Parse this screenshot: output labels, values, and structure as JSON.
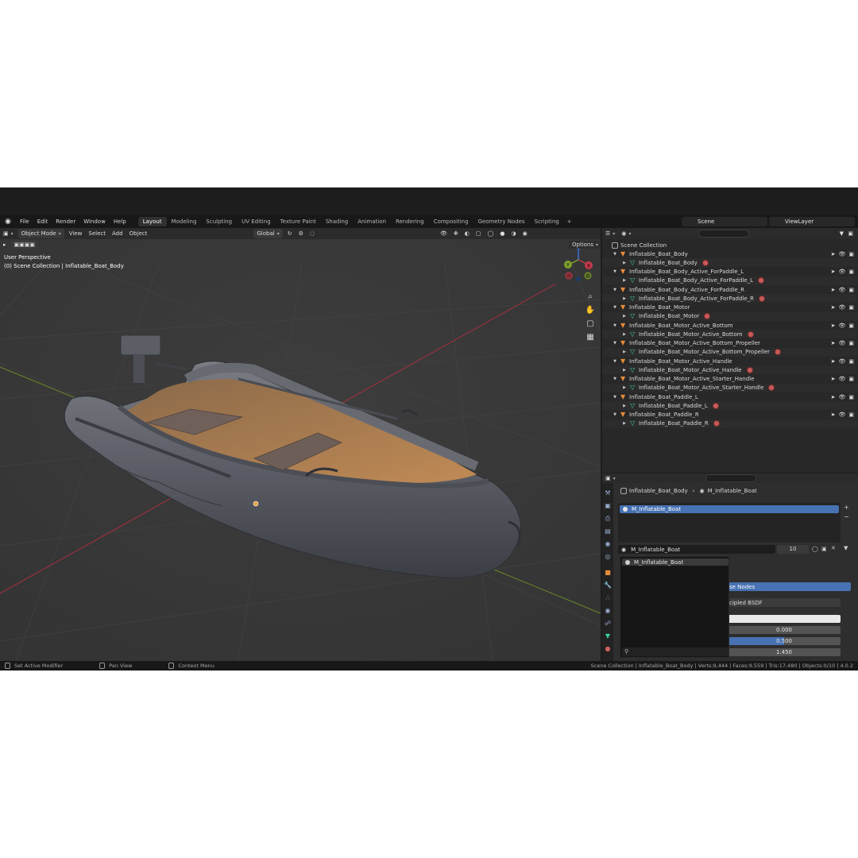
{
  "topbar": {
    "menus": [
      "File",
      "Edit",
      "Render",
      "Window",
      "Help"
    ],
    "workspaces": [
      "Layout",
      "Modeling",
      "Sculpting",
      "UV Editing",
      "Texture Paint",
      "Shading",
      "Animation",
      "Rendering",
      "Compositing",
      "Geometry Nodes",
      "Scripting"
    ],
    "active_workspace": "Layout",
    "add_workspace": "+",
    "scene": "Scene",
    "view_layer": "ViewLayer"
  },
  "viewport": {
    "mode": "Object Mode",
    "menus": [
      "View",
      "Select",
      "Add",
      "Object"
    ],
    "orientation": "Global",
    "info_line1": "User Perspective",
    "info_line2": "(0) Scene Collection | Inflatable_Boat_Body",
    "options": "Options",
    "gizmo_labels": [
      "Z",
      "Y",
      "X"
    ]
  },
  "outliner": {
    "root": "Scene Collection",
    "rows": [
      {
        "label": "Inflatable_Boat_Body",
        "kind": "object"
      },
      {
        "label": "Inflatable_Boat_Body",
        "kind": "mesh"
      },
      {
        "label": "Inflatable_Boat_Body_Active_ForPaddle_L",
        "kind": "object"
      },
      {
        "label": "Inflatable_Boat_Body_Active_ForPaddle_L",
        "kind": "mesh"
      },
      {
        "label": "Inflatable_Boat_Body_Active_ForPaddle_R",
        "kind": "object"
      },
      {
        "label": "Inflatable_Boat_Body_Active_ForPaddle_R",
        "kind": "mesh"
      },
      {
        "label": "Inflatable_Boat_Motor",
        "kind": "object"
      },
      {
        "label": "Inflatable_Boat_Motor",
        "kind": "mesh"
      },
      {
        "label": "Inflatable_Boat_Motor_Active_Bottom",
        "kind": "object"
      },
      {
        "label": "Inflatable_Boat_Motor_Active_Bottom",
        "kind": "mesh"
      },
      {
        "label": "Inflatable_Boat_Motor_Active_Bottom_Propeller",
        "kind": "object"
      },
      {
        "label": "Inflatable_Boat_Motor_Active_Bottom_Propeller",
        "kind": "mesh"
      },
      {
        "label": "Inflatable_Boat_Motor_Active_Handle",
        "kind": "object"
      },
      {
        "label": "Inflatable_Boat_Motor_Active_Handle",
        "kind": "mesh"
      },
      {
        "label": "Inflatable_Boat_Motor_Active_Starter_Handle",
        "kind": "object"
      },
      {
        "label": "Inflatable_Boat_Motor_Active_Starter_Handle",
        "kind": "mesh"
      },
      {
        "label": "Inflatable_Boat_Paddle_L",
        "kind": "object"
      },
      {
        "label": "Inflatable_Boat_Paddle_L",
        "kind": "mesh"
      },
      {
        "label": "Inflatable_Boat_Paddle_R",
        "kind": "object"
      },
      {
        "label": "Inflatable_Boat_Paddle_R",
        "kind": "mesh"
      }
    ]
  },
  "properties": {
    "breadcrumb_object": "Inflatable_Boat_Body",
    "breadcrumb_material": "M_Inflatable_Boat",
    "slot": "M_Inflatable_Boat",
    "material_name": "M_Inflatable_Boat",
    "user_count": "10",
    "dropdown_item": "M_Inflatable_Boat",
    "use_nodes": "se Nodes",
    "surface": "cipled BSDF",
    "value_1": "0.000",
    "value_2": "0.500",
    "value_3": "1.450",
    "value_2_fill": 0.5
  },
  "statusbar": {
    "left1": "Set Active Modifier",
    "left2": "Pan View",
    "left3": "Context Menu",
    "right": "Scene Collection | Inflatable_Boat_Body | Verts:9,444 | Faces:9,559 | Tris:17,480 | Objects:0/10 | 4.0.2"
  },
  "colors": {
    "accent": "#4772b3",
    "object_icon": "#e58c3a",
    "mesh_icon": "#3fd1a0",
    "x_axis": "#c43a4b",
    "y_axis": "#7ea02c"
  }
}
